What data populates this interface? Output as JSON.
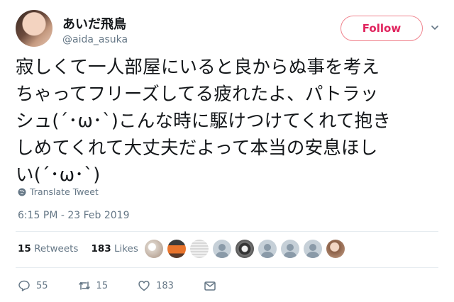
{
  "user": {
    "display_name": "あいだ飛鳥",
    "handle": "@aida_asuka"
  },
  "follow_label": "Follow",
  "tweet_text": "寂しくて一人部屋にいると良からぬ事を考え\nちゃってフリーズしてる疲れたよ、パトラッ\nシュ(´･ω･`)こんな時に駆けつけてくれて抱き\nしめてくれて大丈夫だよって本当の安息ほし\nい(´･ω･`)",
  "translate_label": "Translate Tweet",
  "timestamp": "6:15 PM - 23 Feb 2019",
  "stats": {
    "retweets_count": "15",
    "retweets_label": "Retweets",
    "likes_count": "183",
    "likes_label": "Likes"
  },
  "actions": {
    "replies": "55",
    "retweets": "15",
    "likes": "183"
  },
  "colors": {
    "accent": "#e0245e",
    "muted": "#657786",
    "text": "#14171a"
  },
  "likers": [
    "photo",
    "photo",
    "photo",
    "default",
    "photo",
    "default",
    "default",
    "default",
    "photo"
  ]
}
